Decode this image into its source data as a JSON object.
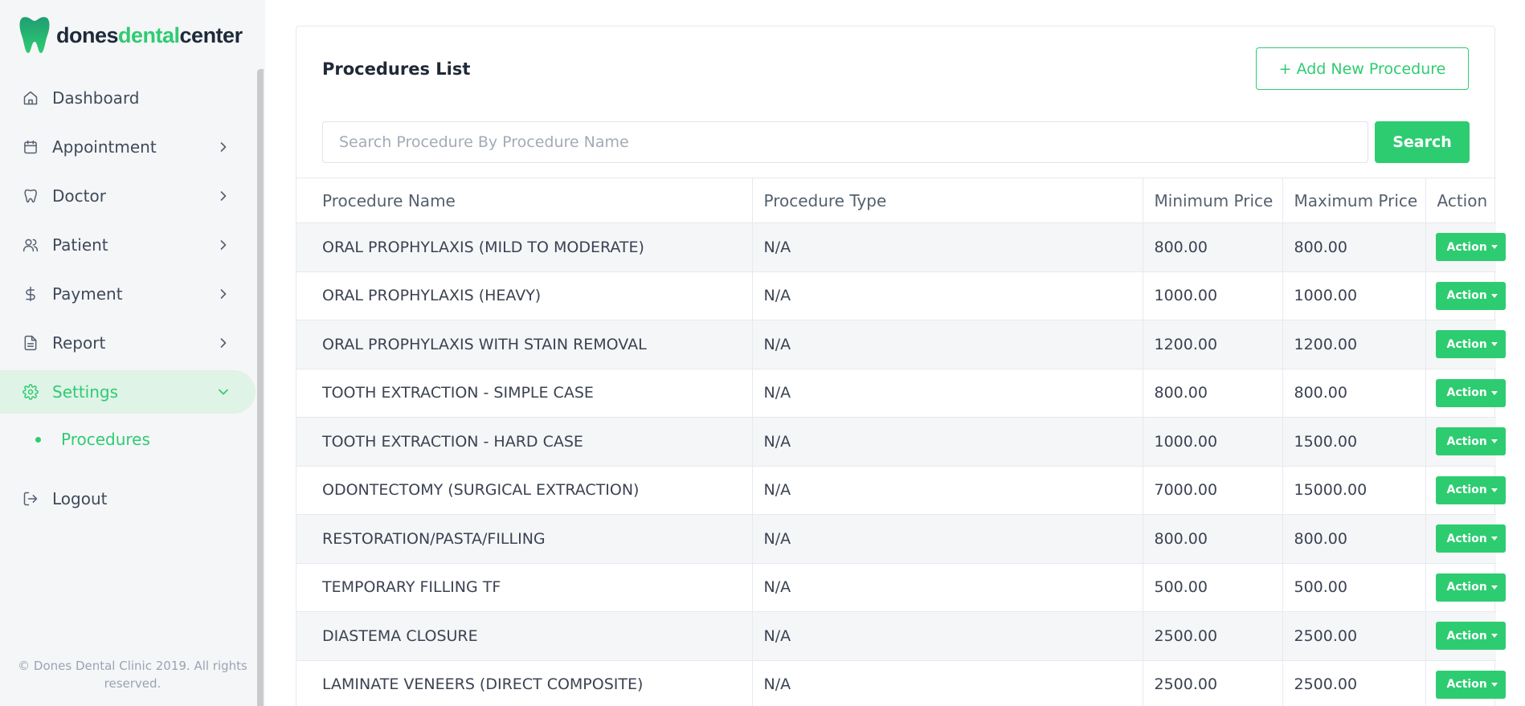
{
  "brand": {
    "part1": "dones",
    "part2": "dental",
    "part3": "center",
    "primary_color": "#2ecc71",
    "dark_color": "#1e2a3a"
  },
  "sidebar": {
    "items": [
      {
        "label": "Dashboard",
        "icon": "home-icon",
        "has_chevron": false
      },
      {
        "label": "Appointment",
        "icon": "calendar-icon",
        "has_chevron": true
      },
      {
        "label": "Doctor",
        "icon": "tooth-icon",
        "has_chevron": true
      },
      {
        "label": "Patient",
        "icon": "users-icon",
        "has_chevron": true
      },
      {
        "label": "Payment",
        "icon": "dollar-icon",
        "has_chevron": true
      },
      {
        "label": "Report",
        "icon": "file-icon",
        "has_chevron": true
      },
      {
        "label": "Settings",
        "icon": "gear-icon",
        "has_chevron": true,
        "active": true
      }
    ],
    "sub_items": [
      {
        "label": "Procedures",
        "active": true
      }
    ],
    "logout": {
      "label": "Logout",
      "icon": "logout-icon"
    },
    "footer": "© Dones Dental Clinic 2019. All rights reserved."
  },
  "main": {
    "title": "Procedures List",
    "add_button": "+ Add New Procedure",
    "search": {
      "placeholder": "Search Procedure By Procedure Name",
      "value": "",
      "button": "Search"
    },
    "table": {
      "columns": [
        "Procedure Name",
        "Procedure Type",
        "Minimum Price",
        "Maximum Price",
        "Action"
      ],
      "action_label": "Action",
      "rows": [
        [
          "ORAL PROPHYLAXIS (MILD TO MODERATE)",
          "N/A",
          "800.00",
          "800.00"
        ],
        [
          "ORAL PROPHYLAXIS (HEAVY)",
          "N/A",
          "1000.00",
          "1000.00"
        ],
        [
          "ORAL PROPHYLAXIS WITH STAIN REMOVAL",
          "N/A",
          "1200.00",
          "1200.00"
        ],
        [
          "TOOTH EXTRACTION - SIMPLE CASE",
          "N/A",
          "800.00",
          "800.00"
        ],
        [
          "TOOTH EXTRACTION - HARD CASE",
          "N/A",
          "1000.00",
          "1500.00"
        ],
        [
          "ODONTECTOMY (SURGICAL EXTRACTION)",
          "N/A",
          "7000.00",
          "15000.00"
        ],
        [
          "RESTORATION/PASTA/FILLING",
          "N/A",
          "800.00",
          "800.00"
        ],
        [
          "TEMPORARY FILLING TF",
          "N/A",
          "500.00",
          "500.00"
        ],
        [
          "DIASTEMA CLOSURE",
          "N/A",
          "2500.00",
          "2500.00"
        ],
        [
          "LAMINATE VENEERS (DIRECT COMPOSITE)",
          "N/A",
          "2500.00",
          "2500.00"
        ]
      ]
    }
  }
}
